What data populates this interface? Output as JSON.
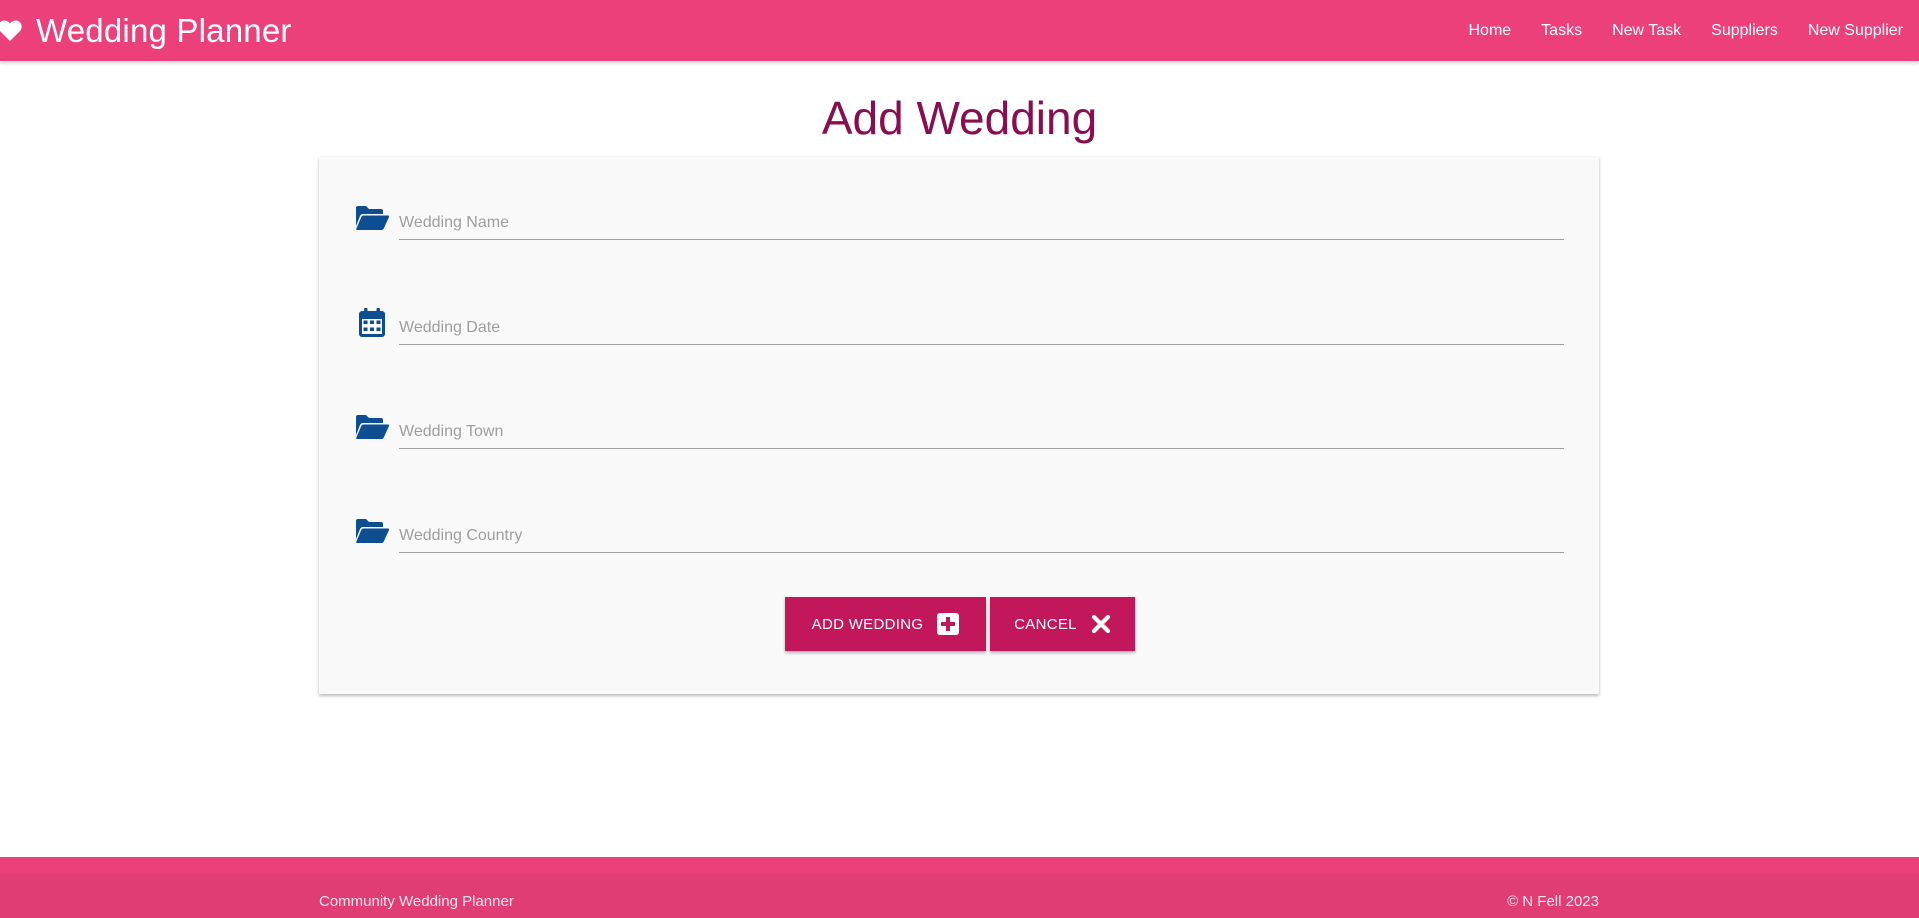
{
  "header": {
    "brand_title": "Wedding Planner",
    "brand_icon": "heart-icon",
    "nav": [
      {
        "label": "Home"
      },
      {
        "label": "Tasks"
      },
      {
        "label": "New Task"
      },
      {
        "label": "Suppliers"
      },
      {
        "label": "New Supplier"
      }
    ]
  },
  "main": {
    "page_title": "Add Wedding",
    "form": {
      "fields": [
        {
          "icon": "folder-open-icon",
          "placeholder": "Wedding Name",
          "value": ""
        },
        {
          "icon": "calendar-icon",
          "placeholder": "Wedding Date",
          "value": ""
        },
        {
          "icon": "folder-open-icon",
          "placeholder": "Wedding Town",
          "value": ""
        },
        {
          "icon": "folder-open-icon",
          "placeholder": "Wedding Country",
          "value": ""
        }
      ],
      "add_button_label": "ADD WEDDING",
      "add_button_icon": "plus-square-icon",
      "cancel_button_label": "CANCEL",
      "cancel_button_icon": "close-icon"
    }
  },
  "footer": {
    "left_text": "Community Wedding Planner",
    "right_text": "© N Fell 2023"
  },
  "colors": {
    "navbar": "#ec407a",
    "title": "#880e4f",
    "button": "#c2185b",
    "icon": "#0d4d92",
    "card": "#f9f9f9"
  }
}
